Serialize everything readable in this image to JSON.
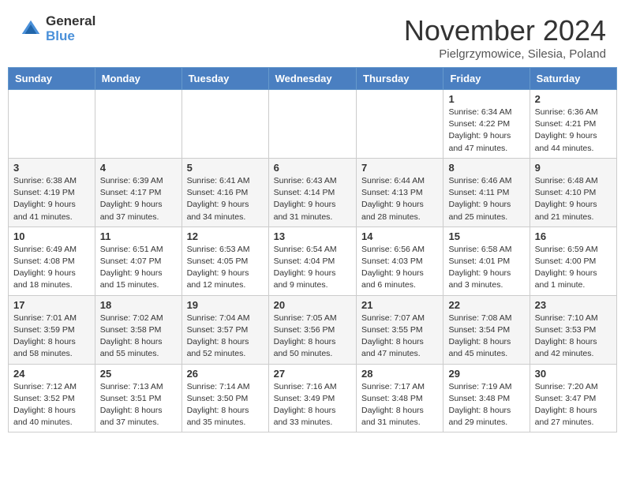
{
  "header": {
    "logo_general": "General",
    "logo_blue": "Blue",
    "title": "November 2024",
    "subtitle": "Pielgrzymowice, Silesia, Poland"
  },
  "columns": [
    "Sunday",
    "Monday",
    "Tuesday",
    "Wednesday",
    "Thursday",
    "Friday",
    "Saturday"
  ],
  "weeks": [
    [
      {
        "num": "",
        "info": ""
      },
      {
        "num": "",
        "info": ""
      },
      {
        "num": "",
        "info": ""
      },
      {
        "num": "",
        "info": ""
      },
      {
        "num": "",
        "info": ""
      },
      {
        "num": "1",
        "info": "Sunrise: 6:34 AM\nSunset: 4:22 PM\nDaylight: 9 hours and 47 minutes."
      },
      {
        "num": "2",
        "info": "Sunrise: 6:36 AM\nSunset: 4:21 PM\nDaylight: 9 hours and 44 minutes."
      }
    ],
    [
      {
        "num": "3",
        "info": "Sunrise: 6:38 AM\nSunset: 4:19 PM\nDaylight: 9 hours and 41 minutes."
      },
      {
        "num": "4",
        "info": "Sunrise: 6:39 AM\nSunset: 4:17 PM\nDaylight: 9 hours and 37 minutes."
      },
      {
        "num": "5",
        "info": "Sunrise: 6:41 AM\nSunset: 4:16 PM\nDaylight: 9 hours and 34 minutes."
      },
      {
        "num": "6",
        "info": "Sunrise: 6:43 AM\nSunset: 4:14 PM\nDaylight: 9 hours and 31 minutes."
      },
      {
        "num": "7",
        "info": "Sunrise: 6:44 AM\nSunset: 4:13 PM\nDaylight: 9 hours and 28 minutes."
      },
      {
        "num": "8",
        "info": "Sunrise: 6:46 AM\nSunset: 4:11 PM\nDaylight: 9 hours and 25 minutes."
      },
      {
        "num": "9",
        "info": "Sunrise: 6:48 AM\nSunset: 4:10 PM\nDaylight: 9 hours and 21 minutes."
      }
    ],
    [
      {
        "num": "10",
        "info": "Sunrise: 6:49 AM\nSunset: 4:08 PM\nDaylight: 9 hours and 18 minutes."
      },
      {
        "num": "11",
        "info": "Sunrise: 6:51 AM\nSunset: 4:07 PM\nDaylight: 9 hours and 15 minutes."
      },
      {
        "num": "12",
        "info": "Sunrise: 6:53 AM\nSunset: 4:05 PM\nDaylight: 9 hours and 12 minutes."
      },
      {
        "num": "13",
        "info": "Sunrise: 6:54 AM\nSunset: 4:04 PM\nDaylight: 9 hours and 9 minutes."
      },
      {
        "num": "14",
        "info": "Sunrise: 6:56 AM\nSunset: 4:03 PM\nDaylight: 9 hours and 6 minutes."
      },
      {
        "num": "15",
        "info": "Sunrise: 6:58 AM\nSunset: 4:01 PM\nDaylight: 9 hours and 3 minutes."
      },
      {
        "num": "16",
        "info": "Sunrise: 6:59 AM\nSunset: 4:00 PM\nDaylight: 9 hours and 1 minute."
      }
    ],
    [
      {
        "num": "17",
        "info": "Sunrise: 7:01 AM\nSunset: 3:59 PM\nDaylight: 8 hours and 58 minutes."
      },
      {
        "num": "18",
        "info": "Sunrise: 7:02 AM\nSunset: 3:58 PM\nDaylight: 8 hours and 55 minutes."
      },
      {
        "num": "19",
        "info": "Sunrise: 7:04 AM\nSunset: 3:57 PM\nDaylight: 8 hours and 52 minutes."
      },
      {
        "num": "20",
        "info": "Sunrise: 7:05 AM\nSunset: 3:56 PM\nDaylight: 8 hours and 50 minutes."
      },
      {
        "num": "21",
        "info": "Sunrise: 7:07 AM\nSunset: 3:55 PM\nDaylight: 8 hours and 47 minutes."
      },
      {
        "num": "22",
        "info": "Sunrise: 7:08 AM\nSunset: 3:54 PM\nDaylight: 8 hours and 45 minutes."
      },
      {
        "num": "23",
        "info": "Sunrise: 7:10 AM\nSunset: 3:53 PM\nDaylight: 8 hours and 42 minutes."
      }
    ],
    [
      {
        "num": "24",
        "info": "Sunrise: 7:12 AM\nSunset: 3:52 PM\nDaylight: 8 hours and 40 minutes."
      },
      {
        "num": "25",
        "info": "Sunrise: 7:13 AM\nSunset: 3:51 PM\nDaylight: 8 hours and 37 minutes."
      },
      {
        "num": "26",
        "info": "Sunrise: 7:14 AM\nSunset: 3:50 PM\nDaylight: 8 hours and 35 minutes."
      },
      {
        "num": "27",
        "info": "Sunrise: 7:16 AM\nSunset: 3:49 PM\nDaylight: 8 hours and 33 minutes."
      },
      {
        "num": "28",
        "info": "Sunrise: 7:17 AM\nSunset: 3:48 PM\nDaylight: 8 hours and 31 minutes."
      },
      {
        "num": "29",
        "info": "Sunrise: 7:19 AM\nSunset: 3:48 PM\nDaylight: 8 hours and 29 minutes."
      },
      {
        "num": "30",
        "info": "Sunrise: 7:20 AM\nSunset: 3:47 PM\nDaylight: 8 hours and 27 minutes."
      }
    ]
  ]
}
